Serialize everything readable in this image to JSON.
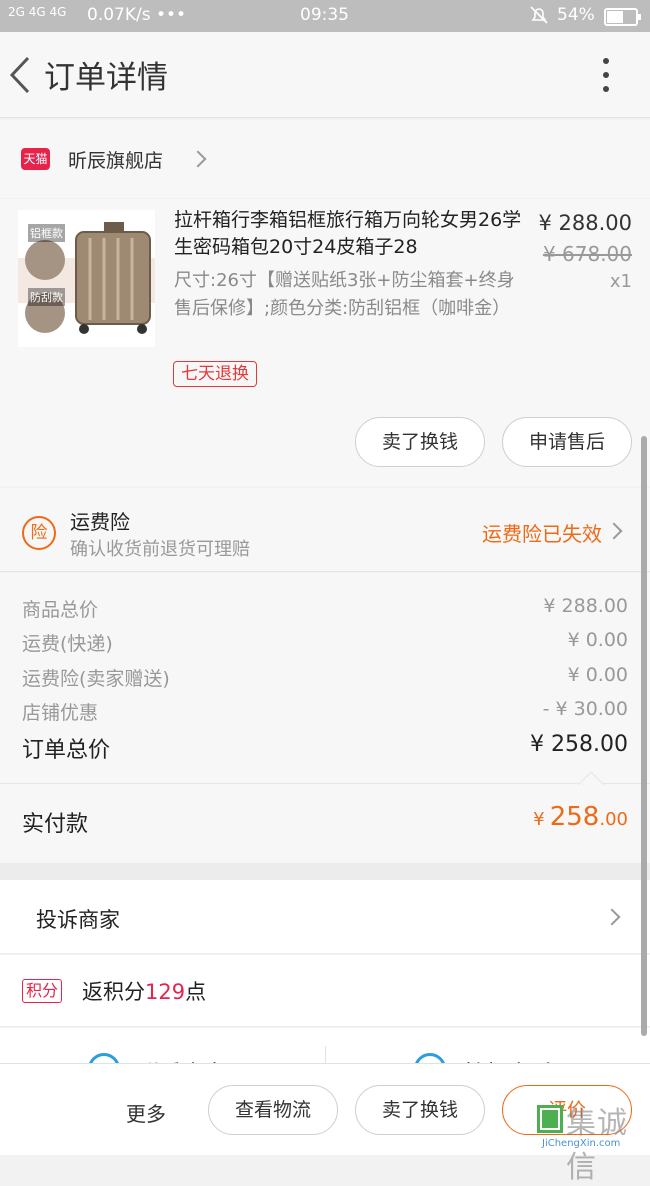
{
  "status_bar": {
    "signal": "2G 4G 4G",
    "speed": "0.07K/s •••",
    "time": "09:35",
    "battery": "54%"
  },
  "header": {
    "title": "订单详情",
    "back_icon": "back-arrow-icon",
    "more_icon": "more-vertical-icon"
  },
  "store": {
    "badge": "天猫",
    "name": "昕辰旗舰店"
  },
  "product": {
    "title": "拉杆箱行李箱铝框旅行箱万向轮女男26学生密码箱包20寸24皮箱子28",
    "spec": "尺寸:26寸【赠送贴纸3张+防尘箱套+终身售后保修】;颜色分类:防刮铝框（咖啡金）",
    "price": "¥ 288.00",
    "original_price": "¥ 678.00",
    "qty": "x1",
    "return_tag": "七天退换",
    "thumb_label1": "铝框款",
    "thumb_label2": "防刮款",
    "btn_sell": "卖了换钱",
    "btn_after_sale": "申请售后"
  },
  "insurance": {
    "icon_text": "险",
    "title": "运费险",
    "subtitle": "确认收货前退货可理赔",
    "status": "运费险已失效",
    "status_color": "#ee6a17"
  },
  "costs": {
    "rows": [
      {
        "label": "商品总价",
        "value": "¥ 288.00"
      },
      {
        "label": "运费(快递)",
        "value": "¥ 0.00"
      },
      {
        "label": "运费险(卖家赠送)",
        "value": "¥ 0.00"
      },
      {
        "label": "店铺优惠",
        "value": "- ¥ 30.00"
      }
    ],
    "total_label": "订单总价",
    "total_value": "¥ 258.00",
    "paid_label": "实付款",
    "paid_currency": "¥",
    "paid_int": "258",
    "paid_dec": ".00",
    "accent": "#ee6a17"
  },
  "complain": {
    "label": "投诉商家"
  },
  "points": {
    "badge": "积分",
    "prefix": "返积分",
    "number": "129",
    "suffix": "点"
  },
  "partial_actions": {
    "left": "联系卖家",
    "right": "拨打电话"
  },
  "bottom_bar": {
    "more": "更多",
    "logistics": "查看物流",
    "sell": "卖了换钱",
    "review": "评价"
  },
  "watermark": {
    "text": "集诚信",
    "url": "JiChengXin.com"
  }
}
